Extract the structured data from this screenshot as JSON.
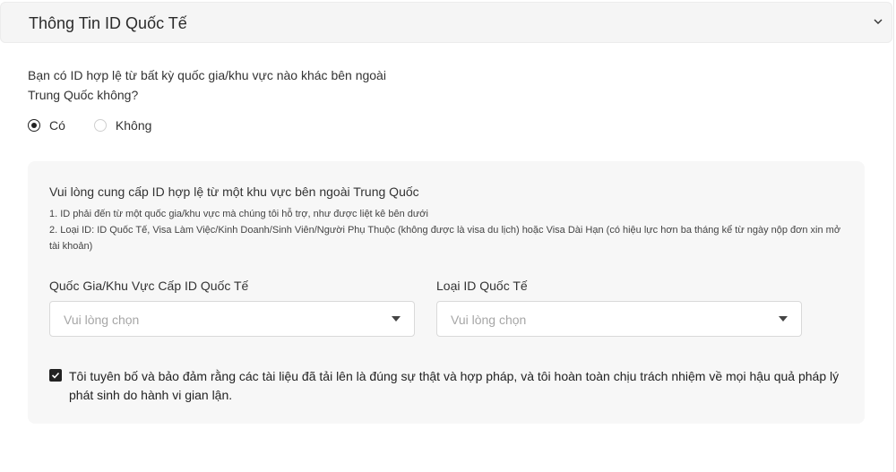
{
  "section": {
    "title": "Thông Tin ID Quốc Tế",
    "chevron_icon": "chevron-down-icon"
  },
  "question": {
    "text_line1": "Bạn có ID hợp lệ từ bất kỳ quốc gia/khu vực nào khác bên ngoài",
    "text_line2": "Trung Quốc không?",
    "options": [
      {
        "label": "Có",
        "selected": true
      },
      {
        "label": "Không",
        "selected": false
      }
    ]
  },
  "panel": {
    "intro": "Vui lòng cung cấp ID hợp lệ từ một khu vực bên ngoài Trung Quốc",
    "notes": [
      "1. ID phải đến từ một quốc gia/khu vực mà chúng tôi hỗ trợ, như được liệt kê bên dưới",
      "2. Loại ID: ID Quốc Tế, Visa Làm Việc/Kinh Doanh/Sinh Viên/Người Phụ Thuộc (không được là visa du lịch) hoặc Visa Dài Hạn (có hiệu lực hơn ba tháng kể từ ngày nộp đơn xin mở tài khoản)"
    ],
    "fields": {
      "country": {
        "label": "Quốc Gia/Khu Vực Cấp ID Quốc Tế",
        "placeholder": "Vui lòng chọn"
      },
      "id_type": {
        "label": "Loại ID Quốc Tế",
        "placeholder": "Vui lòng chọn"
      }
    },
    "declaration": {
      "checked": true,
      "text": "Tôi tuyên bố và bảo đảm rằng các tài liệu đã tải lên là đúng sự thật và hợp pháp, và tôi hoàn toàn chịu trách nhiệm về mọi hậu quả pháp lý phát sinh do hành vi gian lận."
    }
  },
  "colors": {
    "header_bg": "#f5f5f5",
    "panel_bg": "#f7f7f7",
    "checked": "#222222",
    "placeholder": "#a6a6a6"
  }
}
